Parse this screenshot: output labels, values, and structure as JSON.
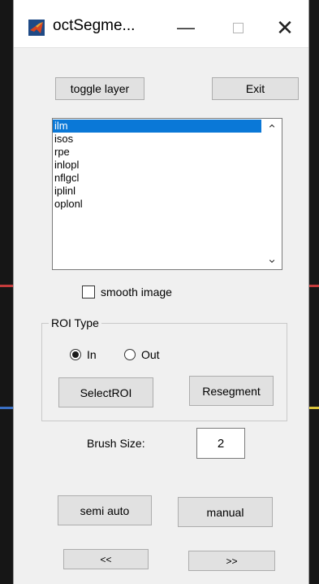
{
  "window": {
    "title": "octSegme...",
    "minimize_symbol": "—",
    "close_symbol": "✕"
  },
  "toolbar": {
    "toggle_layer_label": "toggle layer",
    "exit_label": "Exit"
  },
  "layer_list": {
    "items": [
      "ilm",
      "isos",
      "rpe",
      "inlopl",
      "nflgcl",
      "iplinl",
      "oplonl"
    ],
    "selected_index": 0,
    "scroll_up_symbol": "⌃",
    "scroll_down_symbol": "⌄"
  },
  "smooth_image": {
    "label": "smooth image",
    "checked": false
  },
  "roi": {
    "panel_title": "ROI Type",
    "in_label": "In",
    "out_label": "Out",
    "selected": "In",
    "select_roi_label": "SelectROI",
    "resegment_label": "Resegment"
  },
  "brush": {
    "label": "Brush Size:",
    "value": "2"
  },
  "actions": {
    "semi_auto_label": "semi auto",
    "manual_label": "manual",
    "prev_label": "<<",
    "next_label": ">>"
  },
  "colors": {
    "selection": "#0a78d7",
    "button_face": "#e1e1e1",
    "window_bg": "#f0f0f0",
    "icon_red": "#d9451f",
    "icon_orange": "#f0a030"
  },
  "icons": {
    "app": "matlab-logo-icon"
  }
}
